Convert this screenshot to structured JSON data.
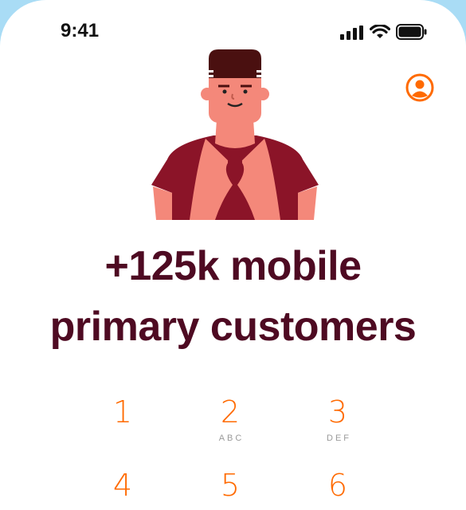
{
  "status_bar": {
    "time": "9:41",
    "icons": [
      "cellular-signal-icon",
      "wifi-icon",
      "battery-icon"
    ]
  },
  "header": {
    "profile_icon": "user-circle-icon",
    "accent_color": "#ff6a00"
  },
  "hero": {
    "illustration": "man-making-heart-hands-illustration"
  },
  "headline": {
    "line1": "+125k mobile",
    "line2": "primary customers",
    "color": "#4e0a22"
  },
  "keypad": {
    "keys": [
      {
        "digit": "1",
        "letters": ""
      },
      {
        "digit": "2",
        "letters": "ABC"
      },
      {
        "digit": "3",
        "letters": "DEF"
      },
      {
        "digit": "4",
        "letters": ""
      },
      {
        "digit": "5",
        "letters": ""
      },
      {
        "digit": "6",
        "letters": ""
      }
    ]
  }
}
